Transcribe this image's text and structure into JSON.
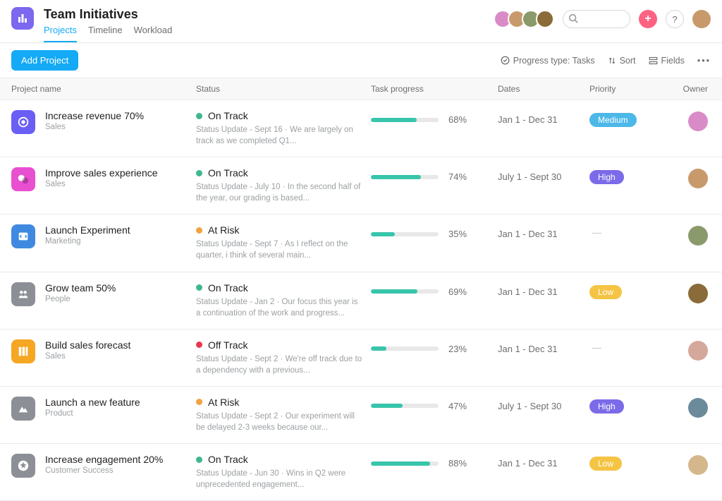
{
  "header": {
    "title": "Team Initiatives",
    "tabs": [
      "Projects",
      "Timeline",
      "Workload"
    ],
    "active_tab": 0,
    "search_placeholder": "",
    "plus": "+",
    "help": "?"
  },
  "toolbar": {
    "add_label": "Add Project",
    "progress_type": "Progress type: Tasks",
    "sort": "Sort",
    "fields": "Fields"
  },
  "columns": {
    "project": "Project name",
    "status": "Status",
    "progress": "Task progress",
    "dates": "Dates",
    "priority": "Priority",
    "owner": "Owner"
  },
  "status_colors": {
    "On Track": "#3db88b",
    "At Risk": "#f1a33e",
    "Off Track": "#e8384f"
  },
  "priority_colors": {
    "Medium": "#4cb8e8",
    "High": "#7b6be8",
    "Low": "#f5c445"
  },
  "projects": [
    {
      "name": "Increase revenue 70%",
      "team": "Sales",
      "icon_bg": "#6a5ef5",
      "icon": "target",
      "status": "On Track",
      "note": "Status Update - Sept 16 · We are largely on track as we completed Q1...",
      "progress": 68,
      "dates": "Jan 1 - Dec 31",
      "priority": "Medium",
      "owner_color": "#d98bc8"
    },
    {
      "name": "Improve sales experience",
      "team": "Sales",
      "icon_bg": "#e84fd1",
      "icon": "chat",
      "status": "On Track",
      "note": "Status Update - July 10 · In the second half of the year, our grading is based...",
      "progress": 74,
      "dates": "July 1 - Sept 30",
      "priority": "High",
      "owner_color": "#c89a6b"
    },
    {
      "name": "Launch Experiment",
      "team": "Marketing",
      "icon_bg": "#3f8ae0",
      "icon": "code",
      "status": "At Risk",
      "note": "Status Update - Sept 7 · As I reflect on the quarter, i think of several main...",
      "progress": 35,
      "dates": "Jan 1 - Dec 31",
      "priority": null,
      "owner_color": "#8b9a6b"
    },
    {
      "name": "Grow team 50%",
      "team": "People",
      "icon_bg": "#8d8f96",
      "icon": "people",
      "status": "On Track",
      "note": "Status Update - Jan 2 · Our focus this year is a continuation of the work and progress...",
      "progress": 69,
      "dates": "Jan 1 - Dec 31",
      "priority": "Low",
      "owner_color": "#8b6b3a"
    },
    {
      "name": "Build sales forecast",
      "team": "Sales",
      "icon_bg": "#f5a623",
      "icon": "columns",
      "status": "Off Track",
      "note": "Status Update - Sept 2 · We're off track due to a dependency with a previous...",
      "progress": 23,
      "dates": "Jan 1 - Dec 31",
      "priority": null,
      "owner_color": "#d4a89a"
    },
    {
      "name": "Launch a new feature",
      "team": "Product",
      "icon_bg": "#8d8f96",
      "icon": "mountain",
      "status": "At Risk",
      "note": "Status Update - Sept 2 · Our experiment will be delayed 2-3 weeks because our...",
      "progress": 47,
      "dates": "July 1 - Sept 30",
      "priority": "High",
      "owner_color": "#6b8b9a"
    },
    {
      "name": "Increase engagement 20%",
      "team": "Customer Success",
      "icon_bg": "#8d8f96",
      "icon": "star",
      "status": "On Track",
      "note": "Status Update - Jun 30 · Wins in Q2 were unprecedented engagement...",
      "progress": 88,
      "dates": "Jan 1 - Dec 31",
      "priority": "Low",
      "owner_color": "#d4b88b"
    }
  ]
}
